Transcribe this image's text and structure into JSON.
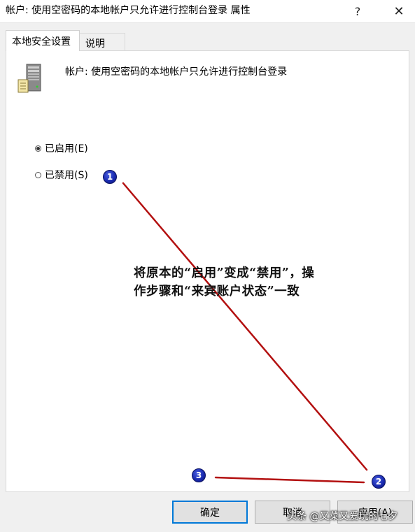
{
  "window": {
    "title": "帐户: 使用空密码的本地帐户只允许进行控制台登录 属性",
    "help_glyph": "?",
    "close_glyph": "✕"
  },
  "tabs": [
    {
      "label": "本地安全设置",
      "active": true
    },
    {
      "label": "说明",
      "active": false
    }
  ],
  "policy": {
    "icon": "server-icon",
    "name": "帐户: 使用空密码的本地帐户只允许进行控制台登录"
  },
  "options": [
    {
      "label": "已启用(E)",
      "checked": true
    },
    {
      "label": "已禁用(S)",
      "checked": false
    }
  ],
  "annotation": {
    "line1": "将原本的“启用”变成“禁用”，操",
    "line2": "作步骤和“来宾账户状态”一致",
    "color": "#c00000"
  },
  "markers": [
    "1",
    "2",
    "3"
  ],
  "buttons": {
    "ok": "确定",
    "cancel": "取消",
    "apply": "应用(A)"
  },
  "watermark": "头条 @又菜又爱玩的七夕",
  "colors": {
    "accent": "#0078d7",
    "marker_blue": "#1a2bb0"
  }
}
